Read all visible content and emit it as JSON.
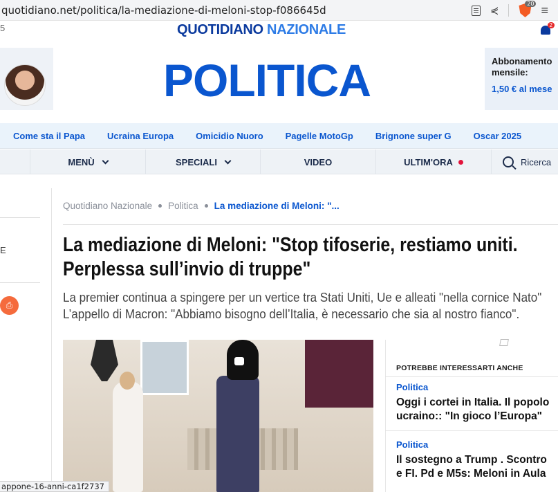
{
  "browser": {
    "url": "quotidiano.net/politica/la-mediazione-di-meloni-stop-f086645d",
    "brave_badge": "20"
  },
  "site": {
    "edge_char": "5",
    "logo_part1": "QUOTIDIANO",
    "logo_part2": "NAZIONALE",
    "notification_count": "2"
  },
  "header": {
    "section_title": "POLITICA",
    "subscription_line1": "Abbonamento",
    "subscription_line2": "mensile:",
    "subscription_price": "1,50 € al mese"
  },
  "trending": {
    "items": [
      "Come sta il Papa",
      "Ucraina Europa",
      "Omicidio Nuoro",
      "Pagelle MotoGp",
      "Brignone super G",
      "Oscar 2025"
    ]
  },
  "nav": {
    "menu": "MENÙ",
    "speciali": "SPECIALI",
    "video": "VIDEO",
    "ultimora": "ULTIM'ORA",
    "search": "Ricerca"
  },
  "left_rail": {
    "letter": "E"
  },
  "breadcrumb": {
    "home": "Quotidiano Nazionale",
    "section": "Politica",
    "current": "La mediazione di Meloni: \"..."
  },
  "article": {
    "headline_line1": "La mediazione di Meloni: \"Stop tifoserie, restiamo uniti.",
    "headline_line2": "Perplessa sull’invio di truppe\"",
    "subhead_line1": "La premier continua a spingere per un vertice tra Stati Uniti, Ue e alleati \"nella cornice Nato\"",
    "subhead_line2": "L’appello di Macron: \"Abbiamo bisogno dell’Italia, è necessario che sia al nostro fianco\"."
  },
  "related": {
    "title": "POTREBBE INTERESSARTI ANCHE",
    "items": [
      {
        "category": "Politica",
        "title_line1": "Oggi i cortei in Italia. Il popolo",
        "title_line2": "ucraino:: \"In gioco l’Europa\""
      },
      {
        "category": "Politica",
        "title_line1": "Il sostegno a Trump . Scontro",
        "title_line2": "e FI. Pd e M5s: Meloni in Aula"
      }
    ]
  },
  "status": {
    "link_preview": "appone-16-anni-ca1f2737"
  },
  "colors": {
    "brand_blue": "#0a56cf",
    "brand_dark": "#0b3a9e",
    "live_dot": "#e2133b",
    "accent_orange": "#f56b3d"
  }
}
